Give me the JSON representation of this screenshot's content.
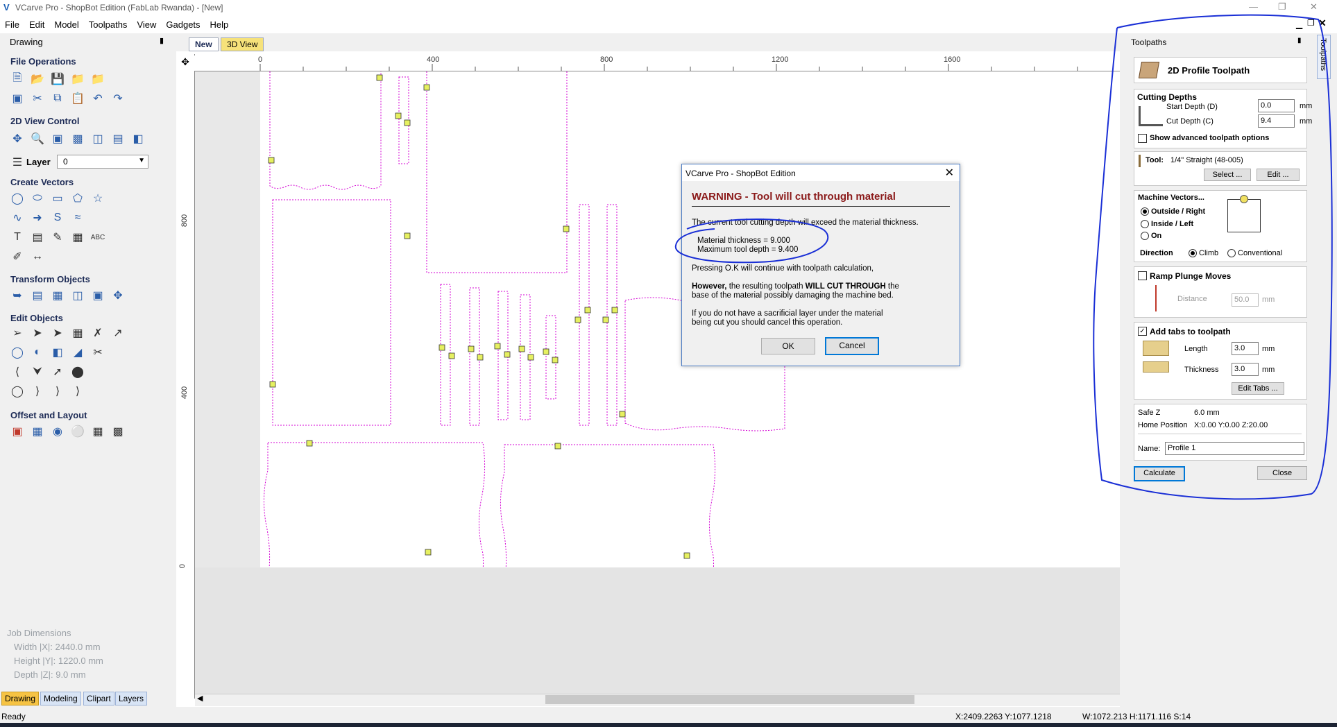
{
  "window": {
    "title": "VCarve Pro - ShopBot Edition (FabLab Rwanda) - [New]"
  },
  "menu": [
    "File",
    "Edit",
    "Model",
    "Toolpaths",
    "View",
    "Gadgets",
    "Help"
  ],
  "left_panel": {
    "header": "Drawing",
    "sections": {
      "file_operations": "File Operations",
      "view_control": "2D View Control",
      "layer_label": "Layer",
      "layer_value": "0",
      "create_vectors": "Create Vectors",
      "transform_objects": "Transform Objects",
      "edit_objects": "Edit Objects",
      "offset_layout": "Offset and Layout"
    },
    "job_dimensions": {
      "title": "Job Dimensions",
      "width": "Width  |X|: 2440.0 mm",
      "height": "Height |Y|: 1220.0 mm",
      "depth": "Depth  |Z|: 9.0 mm"
    },
    "bottom_tabs": [
      "Drawing",
      "Modeling",
      "Clipart",
      "Layers"
    ]
  },
  "doc_tabs": [
    "New",
    "3D View"
  ],
  "ruler": {
    "top_labels": [
      "0",
      "400",
      "800",
      "1200",
      "1600"
    ],
    "left_labels": [
      "800",
      "400",
      "0"
    ]
  },
  "dialog": {
    "title": "VCarve Pro - ShopBot Edition",
    "warning": "WARNING - Tool will cut through material",
    "line1": "The current tool cutting depth will exceed the material thickness.",
    "material_thickness": "Material thickness = 9.000",
    "max_depth": "Maximum tool depth = 9.400",
    "line2": "Pressing O.K will continue with toolpath calculation,",
    "however_bold": "However,",
    "line3a": " the resulting toolpath ",
    "line3_bold": "WILL CUT THROUGH",
    "line3b": " the",
    "line3c": "base of the material possibly damaging the machine bed.",
    "line4a": "If you do not have a sacrificial layer under the material",
    "line4b": "being cut you should cancel this operation.",
    "ok": "OK",
    "cancel": "Cancel"
  },
  "toolpaths_panel": {
    "header": "Toolpaths",
    "vertical_tab": "Toolpaths",
    "toolpath_title": "2D Profile Toolpath",
    "cutting_depths": "Cutting Depths",
    "start_depth_label": "Start Depth (D)",
    "start_depth": "0.0",
    "cut_depth_label": "Cut Depth (C)",
    "cut_depth": "9.4",
    "unit": "mm",
    "advanced": "Show advanced toolpath options",
    "tool_label": "Tool:",
    "tool_value": "1/4\" Straight  (48-005)",
    "select_btn": "Select ...",
    "edit_btn": "Edit ...",
    "machine_vectors": "Machine Vectors...",
    "outside_right": "Outside / Right",
    "inside_left": "Inside / Left",
    "on": "On",
    "direction": "Direction",
    "climb": "Climb",
    "conventional": "Conventional",
    "ramp": "Ramp Plunge Moves",
    "distance_label": "Distance",
    "distance": "50.0",
    "add_tabs": "Add tabs to toolpath",
    "length_label": "Length",
    "length": "3.0",
    "thickness_label": "Thickness",
    "thickness": "3.0",
    "edit_tabs": "Edit Tabs ...",
    "safe_z_label": "Safe Z",
    "safe_z": "6.0 mm",
    "home_label": "Home Position",
    "home": "X:0.00 Y:0.00 Z:20.00",
    "name_label": "Name:",
    "name": "Profile 1",
    "calculate": "Calculate",
    "close": "Close"
  },
  "status": {
    "left": "Ready",
    "coords": "X:2409.2263 Y:1077.1218",
    "dims": "W:1072.213   H:1171.116  S:14"
  }
}
